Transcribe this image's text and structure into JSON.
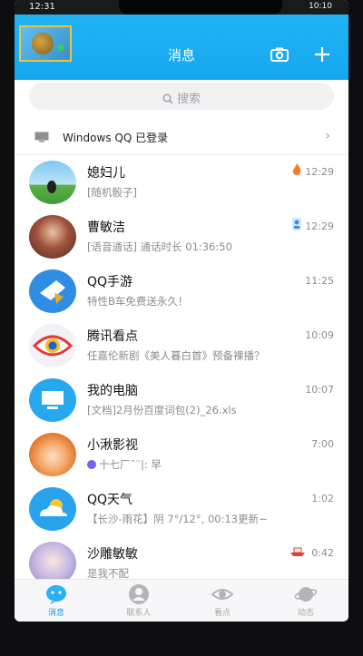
{
  "status_bar": {
    "time": "12:31",
    "right": "10:10"
  },
  "header": {
    "title": "消息"
  },
  "search": {
    "placeholder": "搜索"
  },
  "login_notice": {
    "text": "Windows QQ 已登录"
  },
  "conversations": [
    {
      "name": "媳妇儿",
      "message": "[随机骰子]",
      "time": "12:29"
    },
    {
      "name": "曹敏洁",
      "message": "[语音通话] 通话时长 01:36:50",
      "time": "12:29"
    },
    {
      "name": "QQ手游",
      "message": "特性B车免费送永久！",
      "time": "11:25"
    },
    {
      "name": "腾讯看点",
      "message": "任嘉伦新剧《美人暮白首》预备裸播？",
      "time": "10:09"
    },
    {
      "name": "我的电脑",
      "message": "[文档]2月份百度词包(2)_26.xls",
      "time": "10:07"
    },
    {
      "name": "小湫影视",
      "message": "十七厂ˇ¨|: 早",
      "time": "7:00"
    },
    {
      "name": "QQ天气",
      "message": "【长沙-雨花】阴 7°/12°, 00:13更新~",
      "time": "1:02"
    },
    {
      "name": "沙雕敏敏",
      "message": "是我不配",
      "time": "0:42"
    }
  ],
  "tabs": [
    {
      "label": "消息"
    },
    {
      "label": "联系人"
    },
    {
      "label": "看点"
    },
    {
      "label": "动态"
    }
  ],
  "colors": {
    "header_blue": "#1ba9f1",
    "active_tab": "#1296ea"
  }
}
